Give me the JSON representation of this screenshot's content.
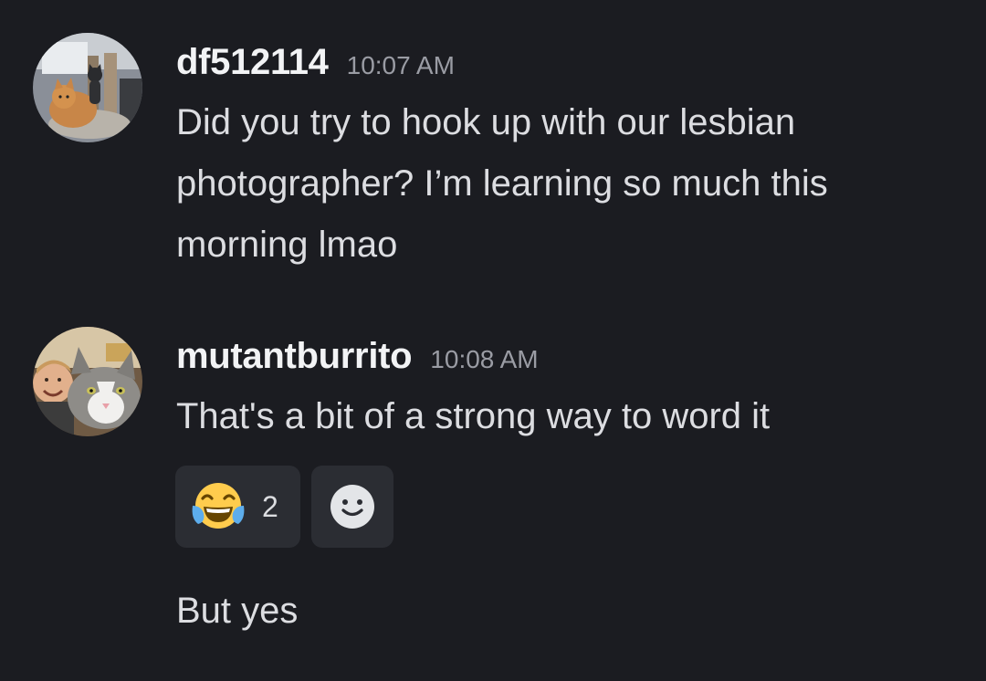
{
  "messages": [
    {
      "username": "df512114",
      "time": "10:07 AM",
      "avatar_icon": "cats-photo-avatar",
      "text": "Did you try to hook up with our lesbian photographer? I’m learning so much this morning lmao"
    },
    {
      "username": "mutantburrito",
      "time": "10:08 AM",
      "avatar_icon": "person-with-cat-avatar",
      "text": "That's a bit of a strong way to word it",
      "reactions": [
        {
          "emoji": "😂",
          "icon": "tears-of-joy-emoji",
          "count": "2"
        },
        {
          "icon": "add-reaction-smiley-icon"
        }
      ],
      "followup": "But yes"
    }
  ],
  "colors": {
    "background": "#1b1c21",
    "username": "#f2f3f5",
    "timestamp": "#9a9ca4",
    "text": "#dcdde1",
    "reaction_bg": "#2b2d33"
  }
}
